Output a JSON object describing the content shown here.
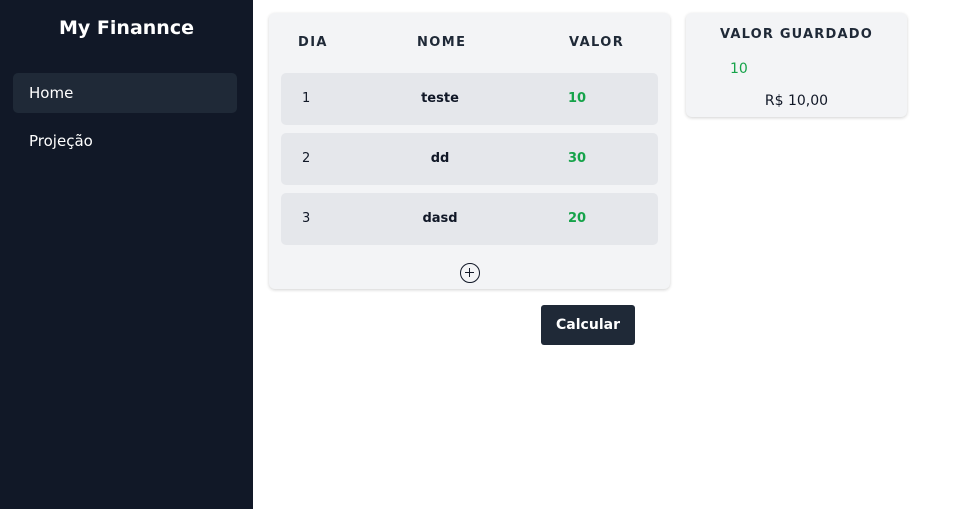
{
  "app": {
    "title": "My Finannce"
  },
  "sidebar": {
    "items": [
      {
        "label": "Home",
        "active": true
      },
      {
        "label": "Projeção",
        "active": false
      }
    ]
  },
  "table": {
    "headers": {
      "dia": "DIA",
      "nome": "NOME",
      "valor": "VALOR"
    },
    "rows": [
      {
        "dia": "1",
        "nome": "teste",
        "valor": "10"
      },
      {
        "dia": "2",
        "nome": "dd",
        "valor": "30"
      },
      {
        "dia": "3",
        "nome": "dasd",
        "valor": "20"
      }
    ],
    "add_icon": "plus-circle-icon"
  },
  "actions": {
    "calculate_label": "Calcular"
  },
  "saved": {
    "title": "VALOR GUARDADO",
    "value": "10",
    "formatted": "R$ 10,00"
  },
  "colors": {
    "sidebar_bg": "#111827",
    "active_item_bg": "#1f2937",
    "card_bg": "#f3f4f6",
    "row_bg": "#e5e7eb",
    "value_green": "#16a34a",
    "button_bg": "#1f2937"
  }
}
